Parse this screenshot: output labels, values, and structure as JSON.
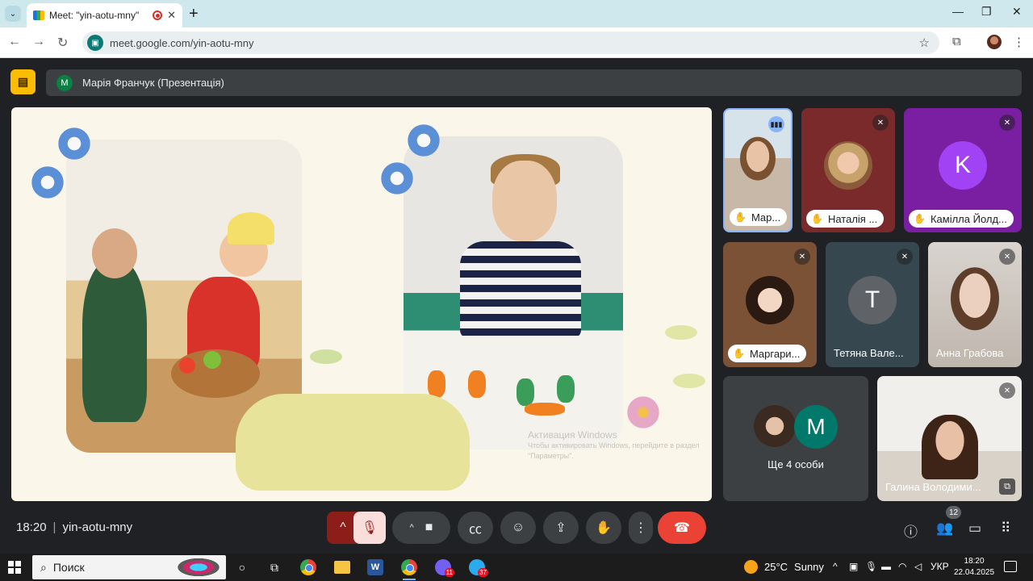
{
  "browser": {
    "tab_title": "Meet: \"yin-aotu-mny\"",
    "url": "meet.google.com/yin-aotu-mny",
    "new_tab_label": "+",
    "tab_close": "✕"
  },
  "meet": {
    "presenter_initial": "M",
    "presenter_label": "Марія Франчук (Презентація)",
    "slide_watermark_title": "Активация Windows",
    "slide_watermark_text": "Чтобы активировать Windows, перейдите в раздел \"Параметры\".",
    "participants": [
      {
        "name": "Мар...",
        "raised_hand": true,
        "speaking": true
      },
      {
        "name": "Наталія ...",
        "raised_hand": true,
        "muted": true
      },
      {
        "name": "Камілла Йолд...",
        "raised_hand": true,
        "muted": true,
        "initial": "K",
        "color": "#a142f4"
      },
      {
        "name": "Маргари...",
        "raised_hand": true,
        "muted": true
      },
      {
        "name": "Тетяна Вале...",
        "muted": true,
        "initial": "T",
        "color": "#5f6368"
      },
      {
        "name": "Анна Грабова",
        "muted": true
      },
      {
        "name": "Ще 4 особи",
        "initial": "M",
        "color": "#00796b"
      },
      {
        "name": "Галина Володими...",
        "muted": true
      }
    ],
    "time": "18:20",
    "meeting_code": "yin-aotu-mny",
    "people_count": "12"
  },
  "taskbar": {
    "search_placeholder": "Поиск",
    "weather_temp": "25°C",
    "weather_desc": "Sunny",
    "lang": "УКР",
    "clock_time": "18:20",
    "clock_date": "22.04.2025",
    "viber_badge": "11",
    "telegram_badge": "37"
  },
  "colors": {
    "accent": "#8ab4f8",
    "end_call": "#ea4335",
    "present_badge": "#fbbc04"
  }
}
